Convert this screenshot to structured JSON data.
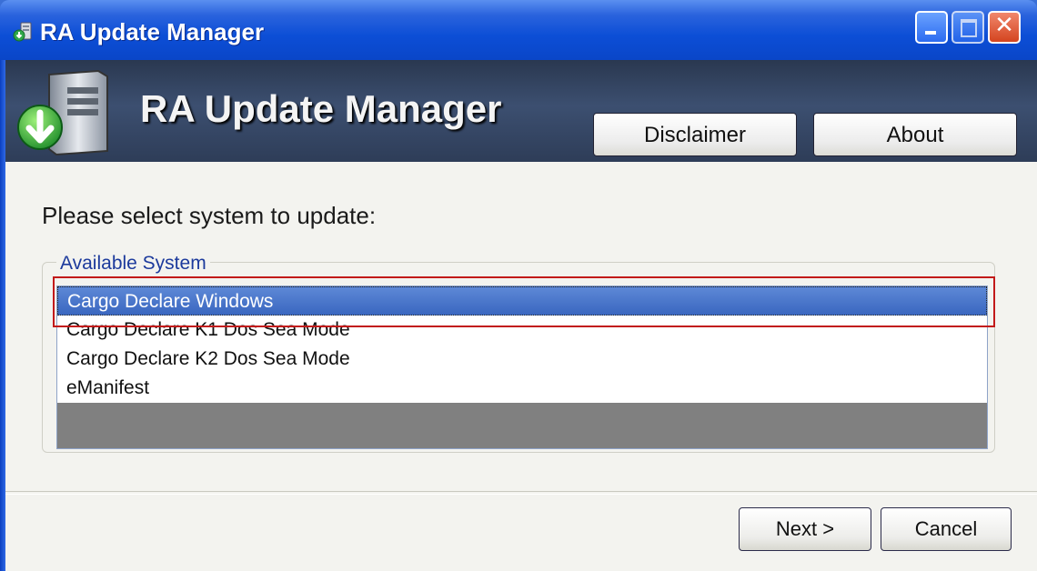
{
  "window": {
    "title": "RA Update Manager",
    "icon": "server-download-icon",
    "controls": [
      "minimize-icon",
      "maximize-icon",
      "close-icon"
    ],
    "close_glyph": "✕"
  },
  "banner": {
    "title": "RA Update Manager",
    "icon": "server-download-icon",
    "disclaimer_label": "Disclaimer",
    "about_label": "About"
  },
  "main": {
    "prompt": "Please select system to update:",
    "group_label": "Available System",
    "systems": [
      "Cargo Declare Windows",
      "Cargo Declare K1 Dos Sea Mode",
      "Cargo Declare K2 Dos Sea Mode",
      "eManifest"
    ],
    "selected_system": "Cargo Declare Windows"
  },
  "footer": {
    "next_label": "Next >",
    "cancel_label": "Cancel"
  },
  "colors": {
    "titlebar": "#0c4ed6",
    "selection": "#3a67c0",
    "highlight_border": "#c21a1a"
  }
}
